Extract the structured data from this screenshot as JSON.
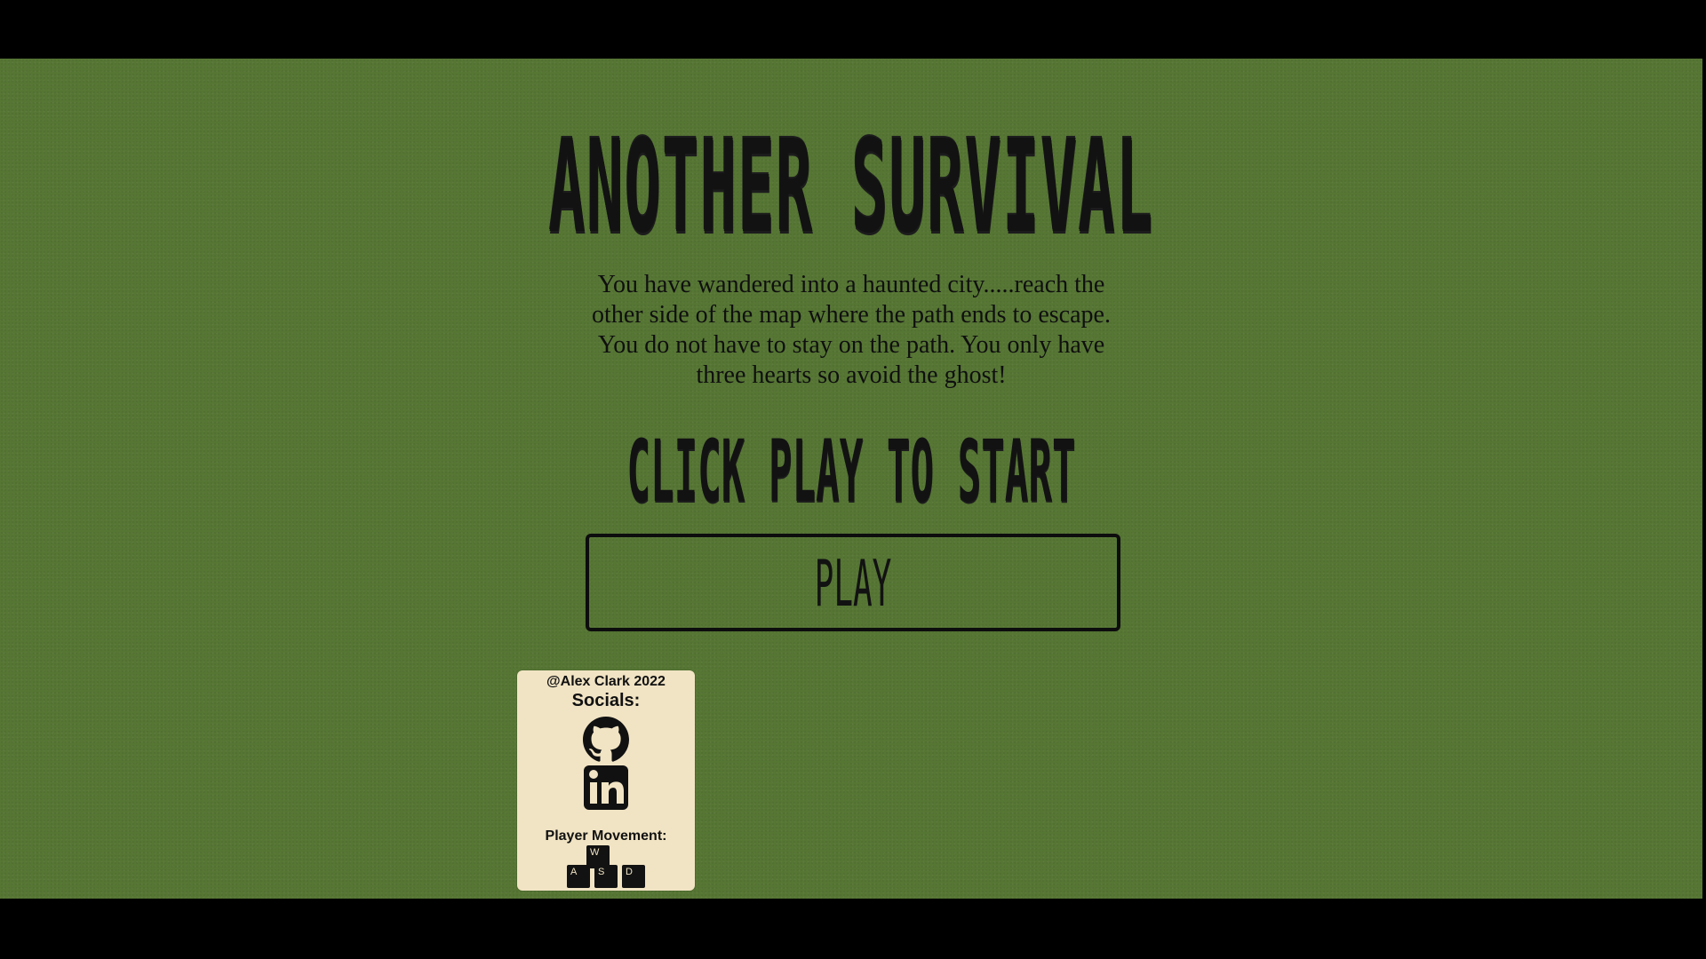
{
  "game": {
    "title": "ANOTHER SURVIVAL",
    "intro": "You have wandered into a haunted city.....reach the other side of the map where the path ends to escape. You do not have to stay on the path. You only have three hearts so avoid the ghost!",
    "prompt": "CLICK PLAY TO START",
    "play_label": "PLAY"
  },
  "footer": {
    "copyright": "@Alex Clark 2022",
    "socials_label": "Socials:",
    "socials": [
      {
        "icon": "github-icon"
      },
      {
        "icon": "linkedin-icon"
      }
    ],
    "movement_label": "Player Movement:",
    "keys": {
      "up": "W",
      "left": "A",
      "down": "S",
      "right": "D"
    }
  },
  "colors": {
    "background": "#567634",
    "text": "#121212",
    "card": "#f1e4c4",
    "letterbox": "#000000"
  }
}
